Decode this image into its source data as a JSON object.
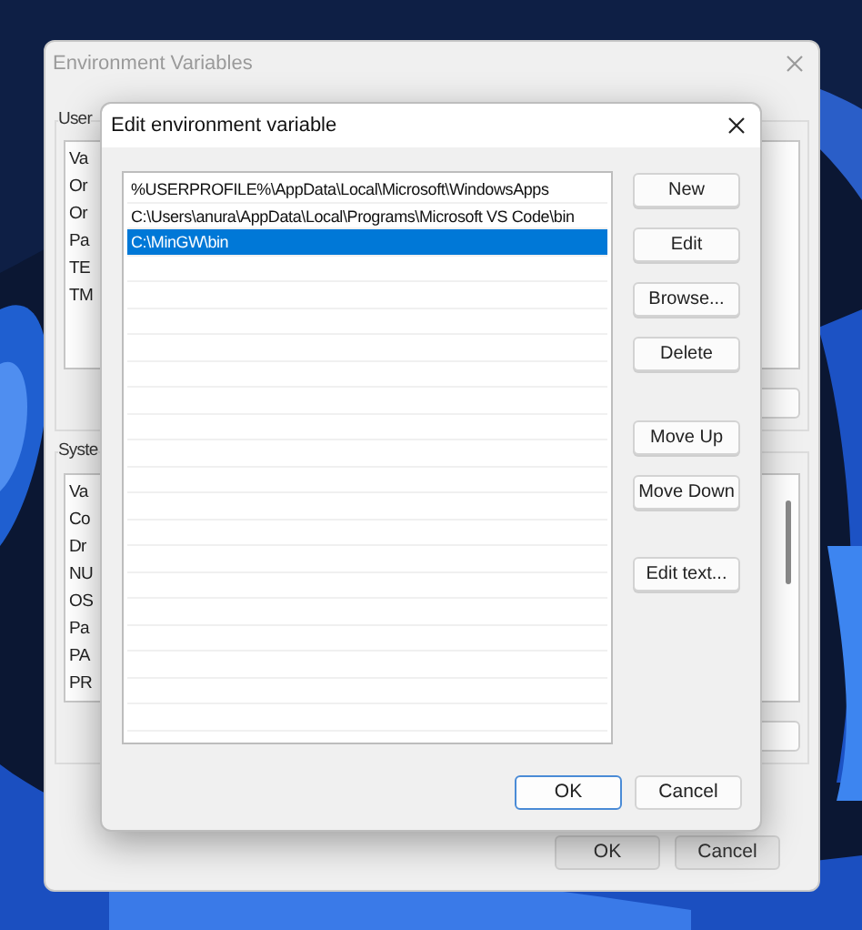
{
  "back_window": {
    "title": "Environment Variables",
    "user_group": {
      "label": "User",
      "rows": [
        "Va",
        "Or",
        "Or",
        "Pa",
        "TE",
        "TM"
      ]
    },
    "system_group": {
      "label": "Syste",
      "rows": [
        "Va",
        "Co",
        "Dr",
        "NU",
        "OS",
        "Pa",
        "PA",
        "PR"
      ]
    },
    "buttons": [
      {
        "label": "OK"
      },
      {
        "label": "Cancel"
      }
    ]
  },
  "dialog": {
    "title": "Edit environment variable",
    "entries": [
      {
        "text": "%USERPROFILE%\\AppData\\Local\\Microsoft\\WindowsApps",
        "selected": false
      },
      {
        "text": "C:\\Users\\anura\\AppData\\Local\\Programs\\Microsoft VS Code\\bin",
        "selected": false
      },
      {
        "text": "C:\\MinGW\\bin",
        "selected": true
      }
    ],
    "side_buttons": [
      [
        "New",
        "Edit",
        "Browse...",
        "Delete"
      ],
      [
        "Move Up",
        "Move Down"
      ],
      [
        "Edit text..."
      ]
    ],
    "footer_buttons": [
      {
        "label": "OK",
        "default": true
      },
      {
        "label": "Cancel",
        "default": false
      }
    ]
  }
}
